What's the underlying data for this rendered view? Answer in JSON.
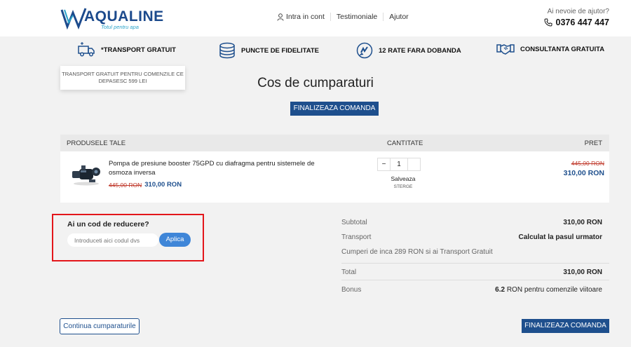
{
  "header": {
    "logo_text": "AQUALINE",
    "logo_tagline": "Totul pentru apa",
    "nav": [
      {
        "label": "Intra in cont",
        "icon": "user-icon"
      },
      {
        "label": "Testimoniale"
      },
      {
        "label": "Ajutor"
      }
    ],
    "help_question": "Ai nevoie de ajutor?",
    "phone": "0376 447 447"
  },
  "features": [
    {
      "label": "*TRANSPORT GRATUIT",
      "icon": "truck-icon"
    },
    {
      "label": "PUNCTE DE FIDELITATE",
      "icon": "coins-icon"
    },
    {
      "label": "12 RATE FARA DOBANDA",
      "icon": "installments-icon"
    },
    {
      "label": "CONSULTANTA GRATUITA",
      "icon": "handshake-icon"
    }
  ],
  "tooltip": "TRANSPORT GRATUIT PENTRU COMENZILE CE DEPASESC 599 LEI",
  "page_title": "Cos de cumparaturi",
  "checkout_label": "FINALIZEAZA COMANDA",
  "cart": {
    "headers": {
      "products": "PRODUSELE TALE",
      "quantity": "CANTITATE",
      "price": "PRET"
    },
    "items": [
      {
        "name": "Pompa de presiune booster 75GPD cu diafragma pentru sistemele de osmoza inversa",
        "old_price": "445,00 RON",
        "price": "310,00 RON",
        "quantity": "1",
        "save_label": "Salveaza",
        "delete_label": "STERGE"
      }
    ]
  },
  "coupon": {
    "title": "Ai un cod de reducere?",
    "placeholder": "Introduceti aici codul dvs",
    "apply_label": "Aplica"
  },
  "summary": {
    "subtotal_label": "Subtotal",
    "subtotal_value": "310,00 RON",
    "transport_label": "Transport",
    "transport_value": "Calculat la pasul urmator",
    "free_shipping_msg": "Cumperi de inca 289 RON si ai Transport Gratuit",
    "total_label": "Total",
    "total_value": "310,00 RON",
    "bonus_label": "Bonus",
    "bonus_points": "6.2",
    "bonus_text": " RON pentru comenzile viitoare"
  },
  "continue_label": "Continua cumparaturile",
  "colors": {
    "brand": "#1e4f8d",
    "accent": "#3f86d8",
    "highlight": "#e3161b",
    "success": "#5a9e1e",
    "sale": "#c0392b"
  }
}
